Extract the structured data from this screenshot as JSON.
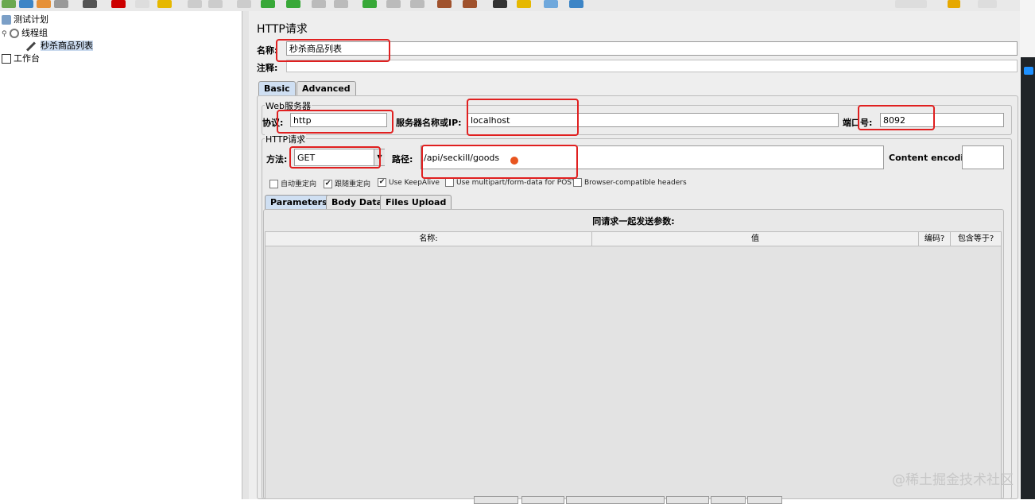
{
  "tree": {
    "test_plan": "测试计划",
    "thread_group": "线程组",
    "sampler": "秒杀商品列表",
    "workbench": "工作台"
  },
  "panel": {
    "title": "HTTP请求",
    "name_label": "名称:",
    "name_value": "秒杀商品列表",
    "comment_label": "注释:"
  },
  "tabs": {
    "basic": "Basic",
    "advanced": "Advanced"
  },
  "web_server": {
    "legend": "Web服务器",
    "protocol_label": "协议:",
    "protocol_value": "http",
    "server_label": "服务器名称或IP:",
    "server_value": "localhost",
    "port_label": "端口号:",
    "port_value": "8092"
  },
  "http_request": {
    "legend": "HTTP请求",
    "method_label": "方法:",
    "method_value": "GET",
    "path_label": "路径:",
    "path_value": "/api/seckill/goods",
    "encoding_label": "Content encoding:",
    "encoding_value": ""
  },
  "options": [
    {
      "label": "自动重定向",
      "checked": false
    },
    {
      "label": "跟随重定向",
      "checked": true
    },
    {
      "label": "Use KeepAlive",
      "checked": true
    },
    {
      "label": "Use multipart/form-data for POST",
      "checked": false
    },
    {
      "label": "Browser-compatible headers",
      "checked": false
    }
  ],
  "subtabs": {
    "parameters": "Parameters",
    "body": "Body Data",
    "files": "Files Upload"
  },
  "params": {
    "title": "同请求一起发送参数:",
    "columns": [
      "名称:",
      "值",
      "编码?",
      "包含等于?"
    ]
  },
  "watermark": "@稀土掘金技术社区",
  "colors": {
    "highlight": "#e02020",
    "selected": "#c9d9ee",
    "tab_active": "#cfdff2"
  }
}
